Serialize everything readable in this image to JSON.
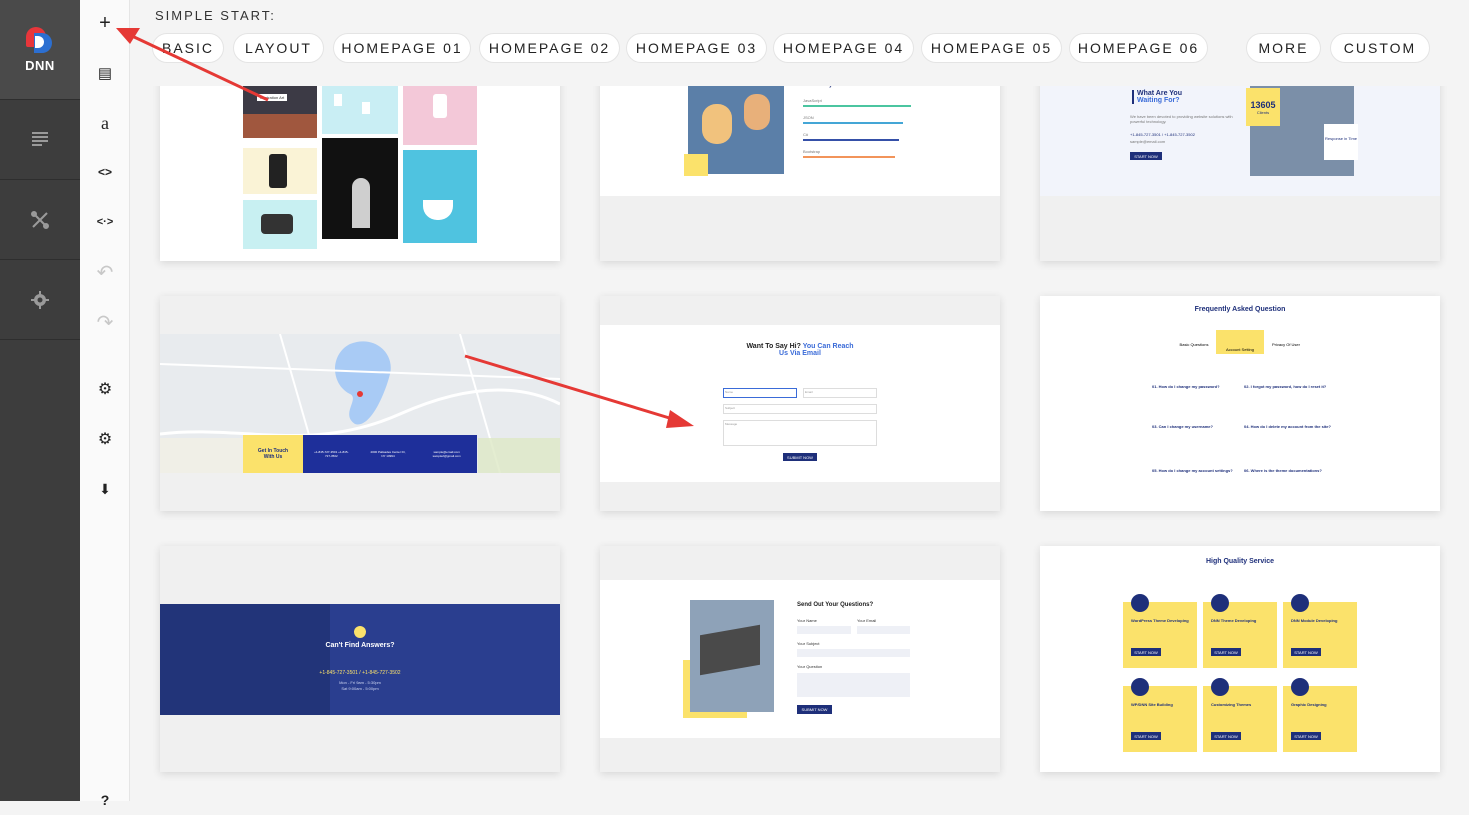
{
  "brand": {
    "logo_text": "DNN"
  },
  "leftbar": {
    "items": [
      {
        "icon": "pages-icon"
      },
      {
        "icon": "tools-icon"
      },
      {
        "icon": "settings-icon"
      }
    ]
  },
  "toolbar": {
    "items": [
      {
        "icon": "add-icon",
        "glyph": "+"
      },
      {
        "icon": "document-icon",
        "glyph": "▤"
      },
      {
        "icon": "text-icon",
        "glyph": "a"
      },
      {
        "icon": "code-icon",
        "glyph": "<>"
      },
      {
        "icon": "code-alt-icon",
        "glyph": "<·>"
      },
      {
        "icon": "undo-icon",
        "glyph": "↶"
      },
      {
        "icon": "redo-icon",
        "glyph": "↷"
      },
      {
        "icon": "gears-icon",
        "glyph": "⚙"
      },
      {
        "icon": "gear-icon",
        "glyph": "⚙"
      },
      {
        "icon": "cloud-download-icon",
        "glyph": "⬇"
      },
      {
        "icon": "help-icon",
        "glyph": "?"
      }
    ]
  },
  "topbar": {
    "section_label": "SIMPLE START:",
    "tabs": [
      "BASIC",
      "LAYOUT",
      "HOMEPAGE 01",
      "HOMEPAGE 02",
      "HOMEPAGE 03",
      "HOMEPAGE 04",
      "HOMEPAGE 05",
      "HOMEPAGE 06",
      "MORE",
      "CUSTOM"
    ]
  },
  "templates": {
    "t1": {
      "label": "Illustration Art"
    },
    "t2": {
      "heading": "You A Stylish Site",
      "bars": [
        "JavaScript",
        "JSON",
        "C#",
        "Bootstrap"
      ]
    },
    "t3": {
      "heading_line1": "What Are You",
      "heading_line2": "Waiting For?",
      "text": "We have been devoted to providing website solutions with powerful technology.",
      "phone": "+1-845-727-3501 / +1-845-727-3502",
      "email": "sample@email.com",
      "button": "START NOW",
      "stat": "13605",
      "stat_label": "Clients",
      "badge": "Response in Time"
    },
    "t4": {
      "cta_line1": "Get In Touch",
      "cta_line2": "With Us",
      "col1": "+1-845-727-3501 +1-845-727-3502",
      "col2": "2000 Palisades Center Dr, NY 10994",
      "col3": "sample@email.com sample2@gmail.com"
    },
    "t5": {
      "heading_a": "Want To Say Hi? ",
      "heading_b": "You Can Reach",
      "heading_c": "Us Via Email",
      "name": "Name",
      "email": "Email",
      "subject": "Subject",
      "message": "Message",
      "button": "SUBMIT NOW"
    },
    "t6": {
      "heading": "Frequently Asked Question",
      "tabs": [
        "Basic Questions",
        "Account Setting",
        "Privacy Of User"
      ],
      "questions": [
        "01. How do I change my password?",
        "02. I forgot my password, how do I reset it?",
        "03. Can I change my username?",
        "04. How do I delete my account from the site?",
        "05. How do I change my account settings?",
        "06. Where is the theme documentations?"
      ]
    },
    "t7": {
      "heading": "Can't Find Answers?",
      "phone": "+1-845-727-3501 / +1-845-727-3502",
      "hours1": "Mon - Fri 9am - 5:30pm",
      "hours2": "Sat 9:00am - 5:00pm"
    },
    "t8": {
      "heading": "Send Out Your Questions?",
      "your_name": "Your Name",
      "your_email": "Your Email",
      "your_subject": "Your Subject",
      "your_question": "Your Question",
      "button": "SUBMIT NOW"
    },
    "t9": {
      "heading": "High Quality Service",
      "items": [
        "WordPress Theme Developing",
        "DNN Theme Developing",
        "DNN Module Developing",
        "WP/DNN Site Building",
        "Customizing Themes",
        "Graphic Designing"
      ],
      "button": "START NOW"
    }
  },
  "colors": {
    "accent": "#e8363b",
    "navy": "#1e2f7a",
    "yellow": "#fbe26b",
    "arrow": "#e53935"
  }
}
